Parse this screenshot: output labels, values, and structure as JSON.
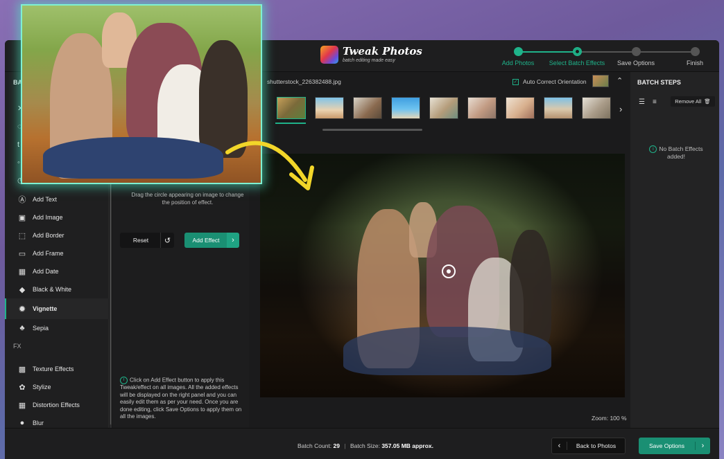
{
  "app": {
    "logo_title": "Tweak Photos",
    "logo_subtitle": "batch editing made easy"
  },
  "steps": [
    {
      "label": "Add Photos",
      "state": "done"
    },
    {
      "label": "Select Batch Effects",
      "state": "active"
    },
    {
      "label": "Save Options",
      "state": "pending"
    },
    {
      "label": "Finish",
      "state": "pending"
    }
  ],
  "sidebar": {
    "title": "BA",
    "items": [
      {
        "label": "Add Text",
        "icon": "add-text-icon"
      },
      {
        "label": "Add Image",
        "icon": "add-image-icon"
      },
      {
        "label": "Add Border",
        "icon": "border-icon"
      },
      {
        "label": "Add Frame",
        "icon": "frame-icon"
      },
      {
        "label": "Add Date",
        "icon": "calendar-icon"
      },
      {
        "label": "Black & White",
        "icon": "contrast-icon"
      },
      {
        "label": "Vignette",
        "icon": "gear-icon",
        "active": true
      },
      {
        "label": "Sepia",
        "icon": "sepia-icon"
      }
    ],
    "fx_section": "FX",
    "fx_items": [
      {
        "label": "Texture Effects",
        "icon": "texture-icon"
      },
      {
        "label": "Stylize",
        "icon": "stylize-icon"
      },
      {
        "label": "Distortion Effects",
        "icon": "grid-icon"
      },
      {
        "label": "Blur",
        "icon": "drop-icon"
      }
    ]
  },
  "effect_panel": {
    "hint_top": "Drag the circle appearing on image to change the position of effect.",
    "reset_label": "Reset",
    "add_effect_label": "Add Effect",
    "hint_bottom": "Click on Add Effect button to apply this Tweak/effect on all images. All the added effects will be displayed on the right panel and you can easily edit them as per your need. Once you are done editing, click Save Options to apply them on all the images."
  },
  "center": {
    "file_name": "shutterstock_226382488.jpg",
    "auto_orient_label": "Auto Correct Orientation",
    "auto_orient_checked": true,
    "zoom_label": "Zoom: 100 %"
  },
  "right_panel": {
    "title": "BATCH STEPS",
    "remove_all_label": "Remove  All",
    "no_effects": "No Batch Effects added!"
  },
  "bottom": {
    "batch_count_label": "Batch Count:",
    "batch_count": "29",
    "batch_size_label": "Batch Size:",
    "batch_size": "357.05 MB approx.",
    "back_label": "Back to Photos",
    "save_label": "Save Options"
  },
  "colors": {
    "accent": "#1fb38a",
    "window_bg": "#1b1b1c",
    "highlight_glow": "#7ff0d3",
    "arrow": "#f2d629"
  }
}
